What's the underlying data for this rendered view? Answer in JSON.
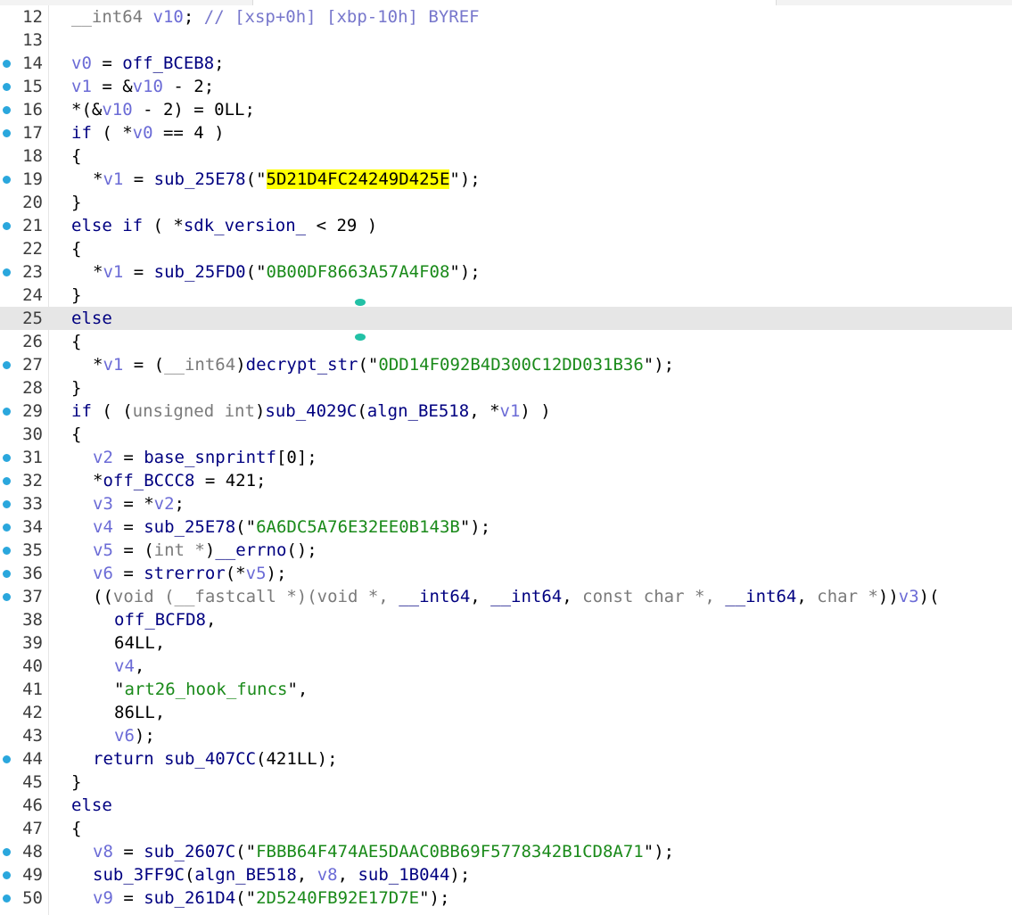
{
  "editor": {
    "lines": [
      {
        "num": "12",
        "bp": false,
        "indent": 0,
        "tokens": [
          [
            "t",
            "__int64"
          ],
          [
            "p",
            " "
          ],
          [
            "v",
            "v10"
          ],
          [
            "p",
            "; "
          ],
          [
            "c",
            "// [xsp+0h] [xbp-10h] BYREF"
          ]
        ]
      },
      {
        "num": "13",
        "bp": false,
        "indent": 0,
        "tokens": []
      },
      {
        "num": "14",
        "bp": true,
        "indent": 0,
        "tokens": [
          [
            "v",
            "v0"
          ],
          [
            "p",
            " = "
          ],
          [
            "n",
            "off_BCEB8"
          ],
          [
            "p",
            ";"
          ]
        ]
      },
      {
        "num": "15",
        "bp": true,
        "indent": 0,
        "tokens": [
          [
            "v",
            "v1"
          ],
          [
            "p",
            " = &"
          ],
          [
            "v",
            "v10"
          ],
          [
            "p",
            " - 2;"
          ]
        ]
      },
      {
        "num": "16",
        "bp": true,
        "indent": 0,
        "tokens": [
          [
            "p",
            "*(&"
          ],
          [
            "v",
            "v10"
          ],
          [
            "p",
            " - 2) = 0LL;"
          ]
        ]
      },
      {
        "num": "17",
        "bp": true,
        "indent": 0,
        "tokens": [
          [
            "k",
            "if"
          ],
          [
            "p",
            " ( *"
          ],
          [
            "v",
            "v0"
          ],
          [
            "p",
            " == 4 )"
          ]
        ]
      },
      {
        "num": "18",
        "bp": false,
        "indent": 0,
        "tokens": [
          [
            "p",
            "{"
          ]
        ]
      },
      {
        "num": "19",
        "bp": true,
        "indent": 1,
        "tokens": [
          [
            "p",
            "*"
          ],
          [
            "v",
            "v1"
          ],
          [
            "p",
            " = "
          ],
          [
            "n",
            "sub_25E78"
          ],
          [
            "p",
            "(\""
          ],
          [
            "hs",
            "5D21D4FC24249D425E"
          ],
          [
            "p",
            "\");"
          ]
        ]
      },
      {
        "num": "20",
        "bp": false,
        "indent": 0,
        "tokens": [
          [
            "p",
            "}"
          ]
        ]
      },
      {
        "num": "21",
        "bp": true,
        "indent": 0,
        "tokens": [
          [
            "k",
            "else if"
          ],
          [
            "p",
            " ( *"
          ],
          [
            "n",
            "sdk_version_"
          ],
          [
            "p",
            " < 29 )"
          ]
        ]
      },
      {
        "num": "22",
        "bp": false,
        "indent": 0,
        "tokens": [
          [
            "p",
            "{"
          ]
        ]
      },
      {
        "num": "23",
        "bp": true,
        "indent": 1,
        "tokens": [
          [
            "p",
            "*"
          ],
          [
            "v",
            "v1"
          ],
          [
            "p",
            " = "
          ],
          [
            "n",
            "sub_25FD0"
          ],
          [
            "p",
            "(\""
          ],
          [
            "s",
            "0B00DF8663A57A4F08"
          ],
          [
            "p",
            "\");"
          ]
        ]
      },
      {
        "num": "24",
        "bp": false,
        "indent": 0,
        "tokens": [
          [
            "p",
            "}"
          ]
        ]
      },
      {
        "num": "25",
        "bp": false,
        "indent": 0,
        "hl": true,
        "tokens": [
          [
            "k",
            "else"
          ]
        ]
      },
      {
        "num": "26",
        "bp": false,
        "indent": 0,
        "tokens": [
          [
            "p",
            "{"
          ]
        ]
      },
      {
        "num": "27",
        "bp": true,
        "indent": 1,
        "tokens": [
          [
            "p",
            "*"
          ],
          [
            "v",
            "v1"
          ],
          [
            "p",
            " = ("
          ],
          [
            "t",
            "__int64"
          ],
          [
            "p",
            ")"
          ],
          [
            "n",
            "decrypt_str"
          ],
          [
            "p",
            "(\""
          ],
          [
            "s",
            "0DD14F092B4D300C12DD031B36"
          ],
          [
            "p",
            "\");"
          ]
        ]
      },
      {
        "num": "28",
        "bp": false,
        "indent": 0,
        "tokens": [
          [
            "p",
            "}"
          ]
        ]
      },
      {
        "num": "29",
        "bp": true,
        "indent": 0,
        "tokens": [
          [
            "k",
            "if"
          ],
          [
            "p",
            " ( ("
          ],
          [
            "t",
            "unsigned int"
          ],
          [
            "p",
            ")"
          ],
          [
            "n",
            "sub_4029C"
          ],
          [
            "p",
            "("
          ],
          [
            "n",
            "algn_BE518"
          ],
          [
            "p",
            ", *"
          ],
          [
            "v",
            "v1"
          ],
          [
            "p",
            ") )"
          ]
        ]
      },
      {
        "num": "30",
        "bp": false,
        "indent": 0,
        "tokens": [
          [
            "p",
            "{"
          ]
        ]
      },
      {
        "num": "31",
        "bp": true,
        "indent": 1,
        "tokens": [
          [
            "v",
            "v2"
          ],
          [
            "p",
            " = "
          ],
          [
            "n",
            "base_snprintf"
          ],
          [
            "p",
            "[0];"
          ]
        ]
      },
      {
        "num": "32",
        "bp": true,
        "indent": 1,
        "tokens": [
          [
            "p",
            "*"
          ],
          [
            "n",
            "off_BCCC8"
          ],
          [
            "p",
            " = 421;"
          ]
        ]
      },
      {
        "num": "33",
        "bp": true,
        "indent": 1,
        "tokens": [
          [
            "v",
            "v3"
          ],
          [
            "p",
            " = *"
          ],
          [
            "v",
            "v2"
          ],
          [
            "p",
            ";"
          ]
        ]
      },
      {
        "num": "34",
        "bp": true,
        "indent": 1,
        "tokens": [
          [
            "v",
            "v4"
          ],
          [
            "p",
            " = "
          ],
          [
            "n",
            "sub_25E78"
          ],
          [
            "p",
            "(\""
          ],
          [
            "s",
            "6A6DC5A76E32EE0B143B"
          ],
          [
            "p",
            "\");"
          ]
        ]
      },
      {
        "num": "35",
        "bp": true,
        "indent": 1,
        "tokens": [
          [
            "v",
            "v5"
          ],
          [
            "p",
            " = ("
          ],
          [
            "t",
            "int *"
          ],
          [
            "p",
            ")"
          ],
          [
            "n",
            "__errno"
          ],
          [
            "p",
            "();"
          ]
        ]
      },
      {
        "num": "36",
        "bp": true,
        "indent": 1,
        "tokens": [
          [
            "v",
            "v6"
          ],
          [
            "p",
            " = "
          ],
          [
            "n",
            "strerror"
          ],
          [
            "p",
            "(*"
          ],
          [
            "v",
            "v5"
          ],
          [
            "p",
            ");"
          ]
        ]
      },
      {
        "num": "37",
        "bp": true,
        "indent": 1,
        "tokens": [
          [
            "p",
            "(("
          ],
          [
            "t",
            "void (__fastcall *)(void *, "
          ],
          [
            "n",
            "__int64"
          ],
          [
            "p",
            ", "
          ],
          [
            "n",
            "__int64"
          ],
          [
            "p",
            ", "
          ],
          [
            "t",
            "const char *, "
          ],
          [
            "n",
            "__int64"
          ],
          [
            "p",
            ", "
          ],
          [
            "t",
            "char *"
          ],
          [
            "p",
            "))"
          ],
          [
            "v",
            "v3"
          ],
          [
            "p",
            ")("
          ]
        ]
      },
      {
        "num": "38",
        "bp": false,
        "indent": 2,
        "tokens": [
          [
            "n",
            "off_BCFD8"
          ],
          [
            "p",
            ","
          ]
        ]
      },
      {
        "num": "39",
        "bp": false,
        "indent": 2,
        "tokens": [
          [
            "p",
            "64LL,"
          ]
        ]
      },
      {
        "num": "40",
        "bp": false,
        "indent": 2,
        "tokens": [
          [
            "v",
            "v4"
          ],
          [
            "p",
            ","
          ]
        ]
      },
      {
        "num": "41",
        "bp": false,
        "indent": 2,
        "tokens": [
          [
            "p",
            "\""
          ],
          [
            "s",
            "art26_hook_funcs"
          ],
          [
            "p",
            "\","
          ]
        ]
      },
      {
        "num": "42",
        "bp": false,
        "indent": 2,
        "tokens": [
          [
            "p",
            "86LL,"
          ]
        ]
      },
      {
        "num": "43",
        "bp": false,
        "indent": 2,
        "tokens": [
          [
            "v",
            "v6"
          ],
          [
            "p",
            ");"
          ]
        ]
      },
      {
        "num": "44",
        "bp": true,
        "indent": 1,
        "tokens": [
          [
            "k",
            "return"
          ],
          [
            "p",
            " "
          ],
          [
            "n",
            "sub_407CC"
          ],
          [
            "p",
            "(421LL);"
          ]
        ]
      },
      {
        "num": "45",
        "bp": false,
        "indent": 0,
        "tokens": [
          [
            "p",
            "}"
          ]
        ]
      },
      {
        "num": "46",
        "bp": false,
        "indent": 0,
        "tokens": [
          [
            "k",
            "else"
          ]
        ]
      },
      {
        "num": "47",
        "bp": false,
        "indent": 0,
        "tokens": [
          [
            "p",
            "{"
          ]
        ]
      },
      {
        "num": "48",
        "bp": true,
        "indent": 1,
        "tokens": [
          [
            "v",
            "v8"
          ],
          [
            "p",
            " = "
          ],
          [
            "n",
            "sub_2607C"
          ],
          [
            "p",
            "(\""
          ],
          [
            "s",
            "FBBB64F474AE5DAAC0BB69F5778342B1CD8A71"
          ],
          [
            "p",
            "\");"
          ]
        ]
      },
      {
        "num": "49",
        "bp": true,
        "indent": 1,
        "tokens": [
          [
            "n",
            "sub_3FF9C"
          ],
          [
            "p",
            "("
          ],
          [
            "n",
            "algn_BE518"
          ],
          [
            "p",
            ", "
          ],
          [
            "v",
            "v8"
          ],
          [
            "p",
            ", "
          ],
          [
            "n",
            "sub_1B044"
          ],
          [
            "p",
            ");"
          ]
        ]
      },
      {
        "num": "50",
        "bp": true,
        "indent": 1,
        "tokens": [
          [
            "v",
            "v9"
          ],
          [
            "p",
            " = "
          ],
          [
            "n",
            "sub_261D4"
          ],
          [
            "p",
            "(\""
          ],
          [
            "s",
            "2D5240FB92E17D7E"
          ],
          [
            "p",
            "\");"
          ]
        ]
      }
    ]
  }
}
